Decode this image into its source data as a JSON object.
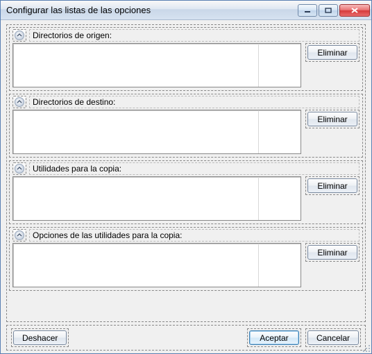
{
  "window": {
    "title": "Configurar las listas de las opciones"
  },
  "sections": [
    {
      "title": "Directorios de origen:",
      "delete_label": "Eliminar"
    },
    {
      "title": "Directorios de destino:",
      "delete_label": "Eliminar"
    },
    {
      "title": "Utilidades para la copia:",
      "delete_label": "Eliminar"
    },
    {
      "title": "Opciones de las utilidades para la copia:",
      "delete_label": "Eliminar"
    }
  ],
  "buttons": {
    "undo": "Deshacer",
    "accept": "Aceptar",
    "cancel": "Cancelar"
  }
}
